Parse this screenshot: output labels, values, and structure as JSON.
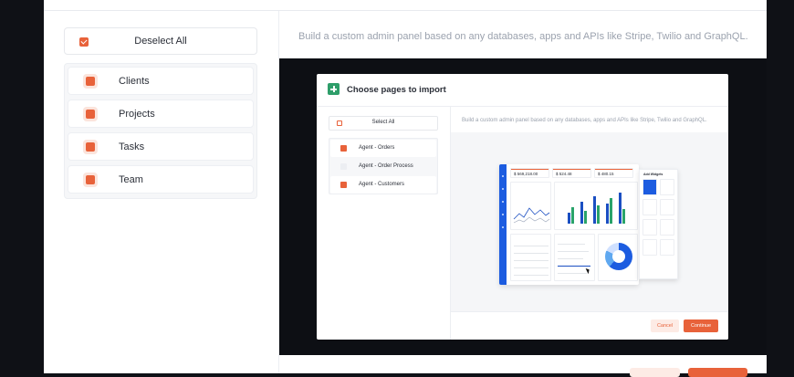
{
  "left_panel": {
    "deselect_all_label": "Deselect All",
    "pages": [
      {
        "label": "Clients",
        "checked": true
      },
      {
        "label": "Projects",
        "checked": true
      },
      {
        "label": "Tasks",
        "checked": true
      },
      {
        "label": "Team",
        "checked": true
      }
    ]
  },
  "right_panel": {
    "headline": "Build a custom admin panel based on any databases, apps and APIs like Stripe, Twilio and GraphQL."
  },
  "video": {
    "dialog_title": "Choose pages to import",
    "select_all_label": "Select All",
    "pages": [
      {
        "label": "Agent - Orders",
        "checked": true
      },
      {
        "label": "Agent - Order Process",
        "checked": false
      },
      {
        "label": "Agent - Customers",
        "checked": true
      }
    ],
    "headline": "Build a custom admin panel based on any databases, apps and APIs like Stripe, Twilio and GraphQL.",
    "dashboard": {
      "stats": [
        "$ 569,218.00",
        "$ 524.48",
        "$ 480.15"
      ],
      "add_widgets_label": "Add Widgets"
    },
    "cancel_label": "Cancel",
    "continue_label": "Continue"
  },
  "colors": {
    "accent": "#e8623a",
    "accent_light": "#fbe4dc",
    "sheet_icon": "#2e9e6a",
    "dashboard_blue": "#1c5ce0"
  }
}
